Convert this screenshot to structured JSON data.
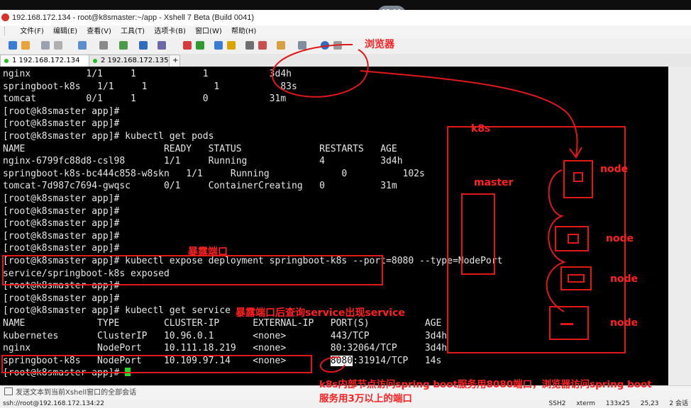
{
  "window": {
    "title": "192.168.172.134 - root@k8smaster:~/app - Xshell 7 Beta (Build 0041)",
    "clock": "02:11"
  },
  "menu": [
    "文件(F)",
    "编辑(E)",
    "查看(V)",
    "工具(T)",
    "选项卡(B)",
    "窗口(W)",
    "帮助(H)"
  ],
  "tabs": [
    {
      "label": "1 192.168.172.134",
      "active": true,
      "dot_color": "#20c020"
    },
    {
      "label": "2 192.168.172.135",
      "active": false,
      "dot_color": "#20c020"
    }
  ],
  "tab_add": "+",
  "tab_close": "×",
  "terminal": {
    "lines": [
      "nginx          1/1     1            1           3d4h",
      "springboot-k8s   1/1     1            1           83s",
      "tomcat         0/1     1            0           31m",
      "[root@k8smaster app]#",
      "[root@k8smaster app]#",
      "[root@k8smaster app]# kubectl get pods",
      "NAME                         READY   STATUS              RESTARTS   AGE",
      "nginx-6799fc88d8-csl98       1/1     Running             4          3d4h",
      "springboot-k8s-bc444c858-w8skn   1/1     Running             0          102s",
      "tomcat-7d987c7694-gwqsc      0/1     ContainerCreating   0          31m",
      "[root@k8smaster app]#",
      "[root@k8smaster app]#",
      "[root@k8smaster app]#",
      "[root@k8smaster app]#",
      "[root@k8smaster app]#",
      "[root@k8smaster app]# kubectl expose deployment springboot-k8s --port=8080 --type=NodePort",
      "service/springboot-k8s exposed",
      "[root@k8smaster app]#",
      "[root@k8smaster app]#",
      "[root@k8smaster app]# kubectl get service",
      "NAME             TYPE        CLUSTER-IP      EXTERNAL-IP   PORT(S)          AGE",
      "kubernetes       ClusterIP   10.96.0.1       <none>        443/TCP          3d4h",
      "nginx            NodePort    10.111.18.219   <none>        80:32064/TCP     3d4h"
    ],
    "springboot_row": {
      "before": "springboot-k8s   NodePort    10.109.97.14    <none>        ",
      "highlight": "8080",
      "after": ":31914/TCP   14s"
    },
    "prompt": "[root@k8smaster app]# "
  },
  "annotations": {
    "browser": "浏览器",
    "expose": "暴露端口",
    "query_service": "暴露端口后查询service出现service",
    "k8s": "k8s",
    "master": "master",
    "node": "node",
    "footer_line1": "k8s内部节点访问spring boot服务用8080端口，浏览器访问spring boot",
    "footer_line2": "服务用3万以上的端口"
  },
  "sendbar": "发送文本到当前Xshell窗口的全部会话",
  "status": {
    "left": "ssh://root@192.168.172.134:22",
    "right": [
      "SSH2",
      "xterm",
      "133x25",
      "25,23",
      "2 会话"
    ]
  },
  "colors": {
    "annotation": "#ff2020",
    "terminal_bg": "#000000",
    "cursor": "#22dd22"
  }
}
